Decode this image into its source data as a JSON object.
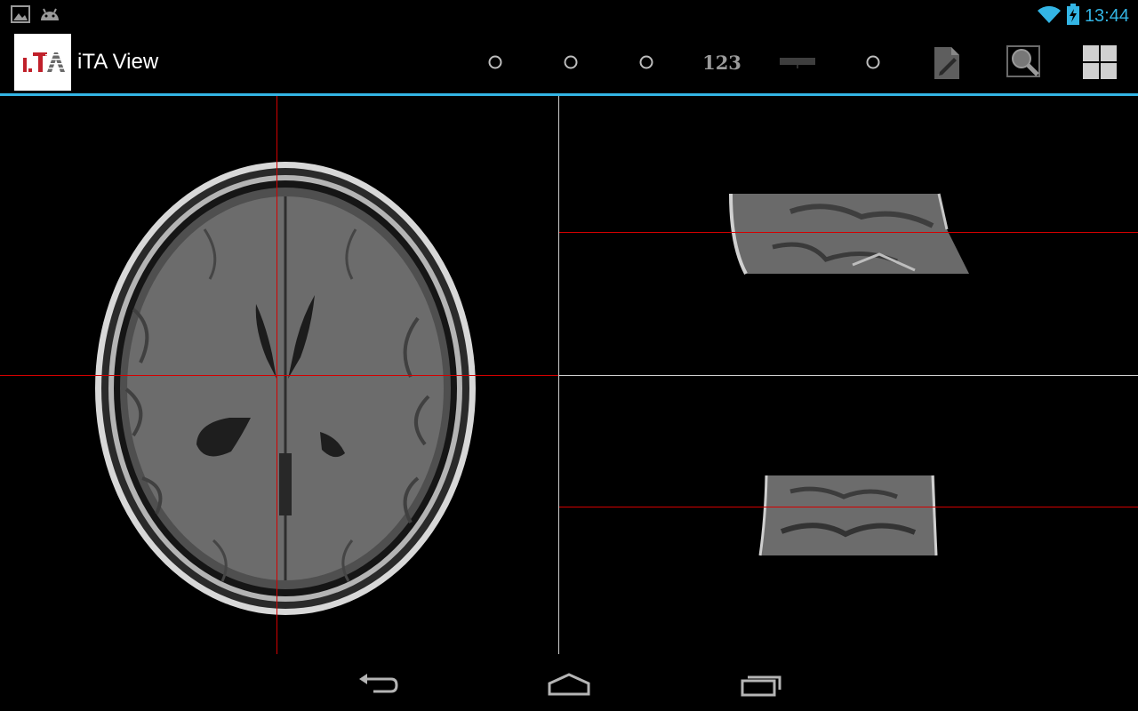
{
  "status_bar": {
    "time": "13:44",
    "icons": [
      "gallery-notification-icon",
      "android-notification-icon",
      "wifi-icon",
      "battery-charging-icon"
    ]
  },
  "action_bar": {
    "title": "iTA View",
    "logo_text": "i.TA",
    "actions": [
      {
        "name": "radio-option-1-icon"
      },
      {
        "name": "radio-option-2-icon"
      },
      {
        "name": "radio-option-3-icon"
      },
      {
        "name": "numbers",
        "label": "123"
      },
      {
        "name": "ruler-icon"
      },
      {
        "name": "radio-option-4-icon"
      },
      {
        "name": "edit-note-icon"
      },
      {
        "name": "zoom-magnifier-icon"
      },
      {
        "name": "layout-grid-icon"
      }
    ]
  },
  "viewer": {
    "views": [
      "axial",
      "sagittal",
      "coronal"
    ],
    "crosshair_color": "#d40000",
    "divider_color": "#cfcfcf"
  },
  "nav_bar": {
    "buttons": [
      "back-icon",
      "home-icon",
      "recent-apps-icon"
    ]
  },
  "colors": {
    "accent": "#33b5e5",
    "background": "#000000"
  }
}
